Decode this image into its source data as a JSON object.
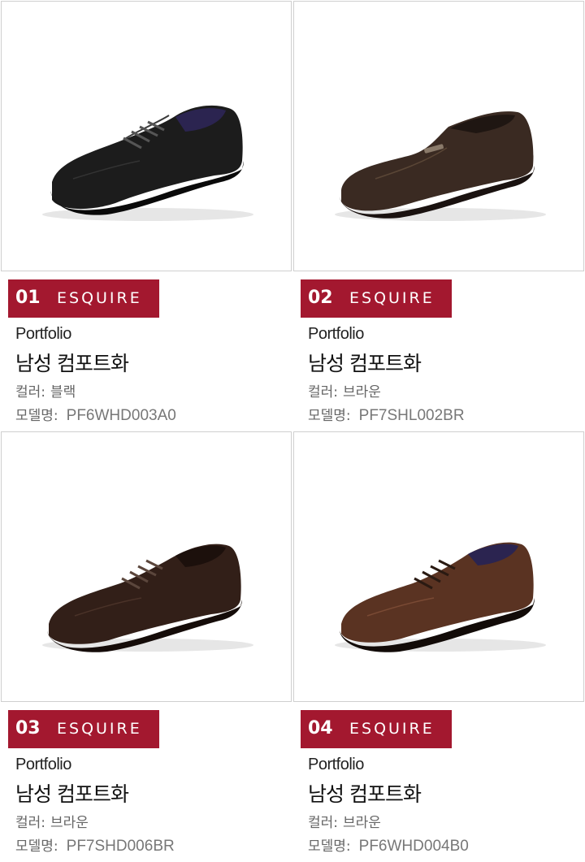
{
  "brand": "ESQUIRE",
  "colors": {
    "accent": "#a3182f",
    "border": "#cfcfcf"
  },
  "products": [
    {
      "num": "01",
      "series": "Portfolio",
      "title": "남성 컴포트화",
      "color_label": "컬러:",
      "color": "블랙",
      "model_label": "모델명:",
      "model": "PF6WHD003A0",
      "shoe_color": "#1c1c1c",
      "image": "black-lace-up-shoe"
    },
    {
      "num": "02",
      "series": "Portfolio",
      "title": "남성 컴포트화",
      "color_label": "컬러:",
      "color": "브라운",
      "model_label": "모델명:",
      "model": "PF7SHL002BR",
      "shoe_color": "#3a2a22",
      "image": "brown-slip-on-shoe"
    },
    {
      "num": "03",
      "series": "Portfolio",
      "title": "남성 컴포트화",
      "color_label": "컬러:",
      "color": "브라운",
      "model_label": "모델명:",
      "model": "PF7SHD006BR",
      "shoe_color": "#321f18",
      "image": "dark-brown-lace-up-shoe"
    },
    {
      "num": "04",
      "series": "Portfolio",
      "title": "남성 컴포트화",
      "color_label": "컬러:",
      "color": "브라운",
      "model_label": "모델명:",
      "model": "PF6WHD004B0",
      "shoe_color": "#5a3322",
      "image": "brown-lace-up-shoe"
    }
  ]
}
